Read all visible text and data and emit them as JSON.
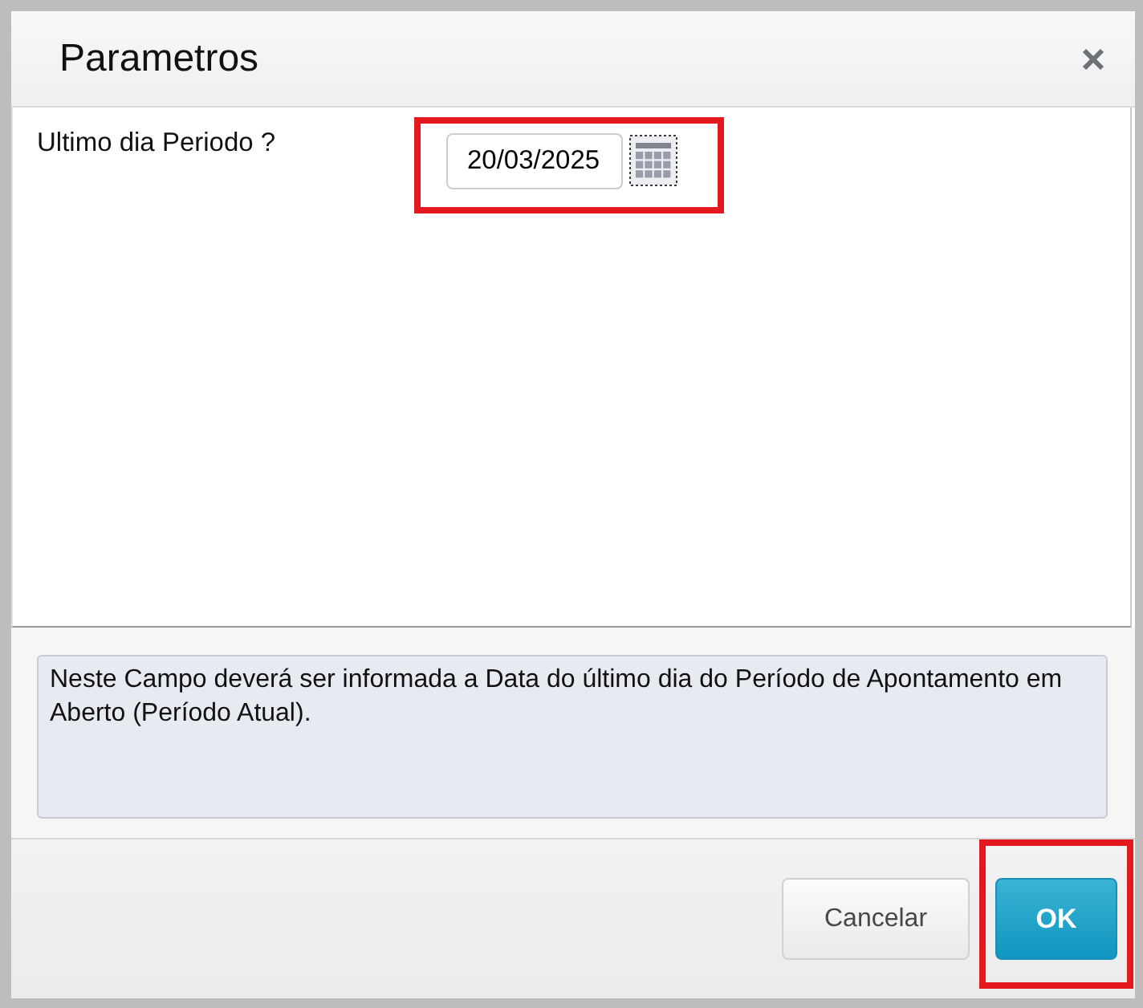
{
  "dialog": {
    "title": "Parametros"
  },
  "parameters": [
    {
      "kind": "date",
      "label": "Ultimo dia Periodo ?",
      "value": "20/03/2025",
      "highlighted": true
    }
  ],
  "help_text": "Neste Campo deverá ser informada a Data do último dia do Período de Apontamento em Aberto (Período Atual).",
  "buttons": [
    {
      "kind": "secondary",
      "label": "Cancelar",
      "highlighted": false
    },
    {
      "kind": "primary",
      "label": "OK",
      "highlighted": true
    }
  ]
}
